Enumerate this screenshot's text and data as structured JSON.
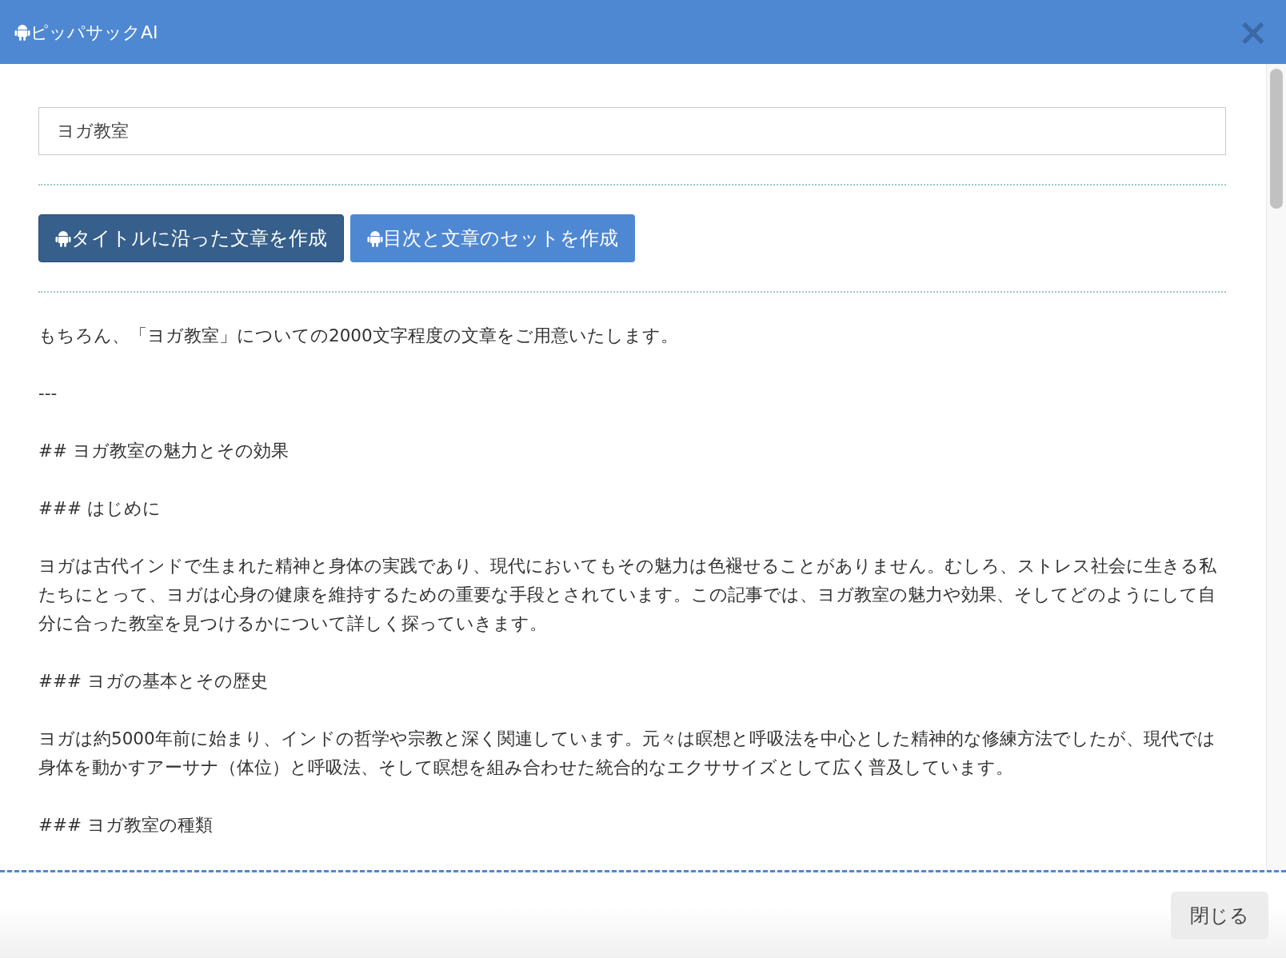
{
  "window": {
    "title": "ピッパサックAI",
    "close": "×"
  },
  "title_field": {
    "value": "ヨガ教室"
  },
  "buttons": [
    {
      "label": "タイトルに沿った文章を作成",
      "selected": true
    },
    {
      "label": "目次と文章のセットを作成",
      "selected": false
    }
  ],
  "output": [
    "もちろん、「ヨガ教室」についての2000文字程度の文章をご用意いたします。",
    "---",
    "## ヨガ教室の魅力とその効果",
    "### はじめに",
    "ヨガは古代インドで生まれた精神と身体の実践であり、現代においてもその魅力は色褪せることがありません。むしろ、ストレス社会に生きる私たちにとって、ヨガは心身の健康を維持するための重要な手段とされています。この記事では、ヨガ教室の魅力や効果、そしてどのようにして自分に合った教室を見つけるかについて詳しく探っていきます。",
    "### ヨガの基本とその歴史",
    "ヨガは約5000年前に始まり、インドの哲学や宗教と深く関連しています。元々は瞑想と呼吸法を中心とした精神的な修練方法でしたが、現代では身体を動かすアーサナ（体位）と呼吸法、そして瞑想を組み合わせた統合的なエクササイズとして広く普及しています。",
    "### ヨガ教室の種類"
  ],
  "footer": {
    "close_button": "閉じる"
  }
}
